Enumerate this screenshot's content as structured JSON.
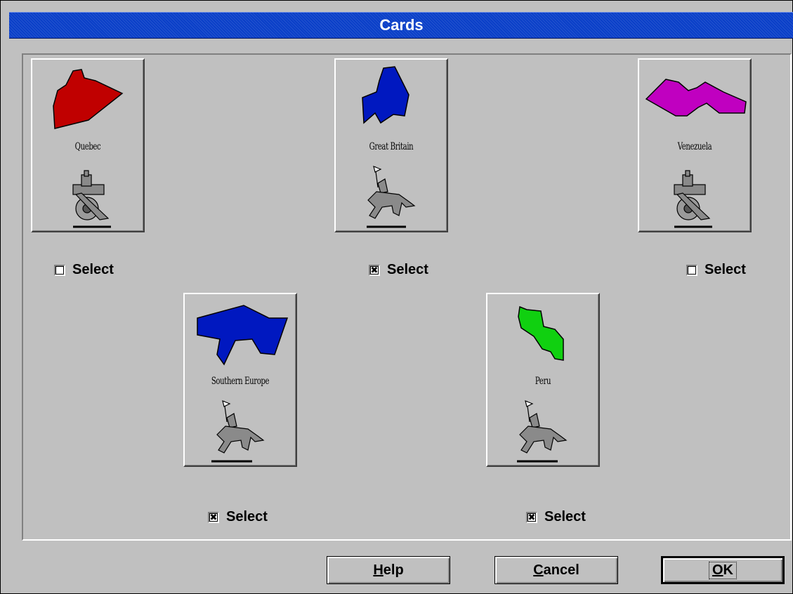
{
  "dialog": {
    "title": "Cards"
  },
  "cards": [
    {
      "name": "Quebec",
      "territory_color": "#c00000",
      "unit": "cannon",
      "select_label": "Select",
      "selected": false
    },
    {
      "name": "Great Britain",
      "territory_color": "#0018c0",
      "unit": "cavalry",
      "select_label": "Select",
      "selected": true
    },
    {
      "name": "Venezuela",
      "territory_color": "#c000c0",
      "unit": "cannon",
      "select_label": "Select",
      "selected": false
    },
    {
      "name": "Southern Europe",
      "territory_color": "#0018c0",
      "unit": "cavalry",
      "select_label": "Select",
      "selected": true
    },
    {
      "name": "Peru",
      "territory_color": "#10d010",
      "unit": "cavalry",
      "select_label": "Select",
      "selected": true
    }
  ],
  "buttons": {
    "help": {
      "accel": "H",
      "rest": "elp"
    },
    "cancel": {
      "accel": "C",
      "rest": "ancel"
    },
    "ok": {
      "accel": "O",
      "rest": "K"
    }
  }
}
